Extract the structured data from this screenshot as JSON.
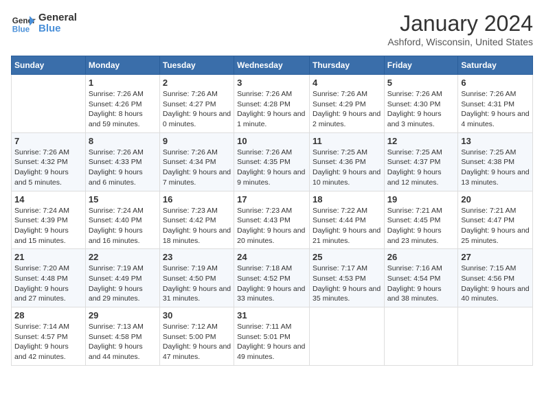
{
  "logo": {
    "line1": "General",
    "line2": "Blue"
  },
  "title": "January 2024",
  "location": "Ashford, Wisconsin, United States",
  "days_of_week": [
    "Sunday",
    "Monday",
    "Tuesday",
    "Wednesday",
    "Thursday",
    "Friday",
    "Saturday"
  ],
  "weeks": [
    [
      {
        "day": "",
        "sunrise": "",
        "sunset": "",
        "daylight": ""
      },
      {
        "day": "1",
        "sunrise": "Sunrise: 7:26 AM",
        "sunset": "Sunset: 4:26 PM",
        "daylight": "Daylight: 8 hours and 59 minutes."
      },
      {
        "day": "2",
        "sunrise": "Sunrise: 7:26 AM",
        "sunset": "Sunset: 4:27 PM",
        "daylight": "Daylight: 9 hours and 0 minutes."
      },
      {
        "day": "3",
        "sunrise": "Sunrise: 7:26 AM",
        "sunset": "Sunset: 4:28 PM",
        "daylight": "Daylight: 9 hours and 1 minute."
      },
      {
        "day": "4",
        "sunrise": "Sunrise: 7:26 AM",
        "sunset": "Sunset: 4:29 PM",
        "daylight": "Daylight: 9 hours and 2 minutes."
      },
      {
        "day": "5",
        "sunrise": "Sunrise: 7:26 AM",
        "sunset": "Sunset: 4:30 PM",
        "daylight": "Daylight: 9 hours and 3 minutes."
      },
      {
        "day": "6",
        "sunrise": "Sunrise: 7:26 AM",
        "sunset": "Sunset: 4:31 PM",
        "daylight": "Daylight: 9 hours and 4 minutes."
      }
    ],
    [
      {
        "day": "7",
        "sunrise": "Sunrise: 7:26 AM",
        "sunset": "Sunset: 4:32 PM",
        "daylight": "Daylight: 9 hours and 5 minutes."
      },
      {
        "day": "8",
        "sunrise": "Sunrise: 7:26 AM",
        "sunset": "Sunset: 4:33 PM",
        "daylight": "Daylight: 9 hours and 6 minutes."
      },
      {
        "day": "9",
        "sunrise": "Sunrise: 7:26 AM",
        "sunset": "Sunset: 4:34 PM",
        "daylight": "Daylight: 9 hours and 7 minutes."
      },
      {
        "day": "10",
        "sunrise": "Sunrise: 7:26 AM",
        "sunset": "Sunset: 4:35 PM",
        "daylight": "Daylight: 9 hours and 9 minutes."
      },
      {
        "day": "11",
        "sunrise": "Sunrise: 7:25 AM",
        "sunset": "Sunset: 4:36 PM",
        "daylight": "Daylight: 9 hours and 10 minutes."
      },
      {
        "day": "12",
        "sunrise": "Sunrise: 7:25 AM",
        "sunset": "Sunset: 4:37 PM",
        "daylight": "Daylight: 9 hours and 12 minutes."
      },
      {
        "day": "13",
        "sunrise": "Sunrise: 7:25 AM",
        "sunset": "Sunset: 4:38 PM",
        "daylight": "Daylight: 9 hours and 13 minutes."
      }
    ],
    [
      {
        "day": "14",
        "sunrise": "Sunrise: 7:24 AM",
        "sunset": "Sunset: 4:39 PM",
        "daylight": "Daylight: 9 hours and 15 minutes."
      },
      {
        "day": "15",
        "sunrise": "Sunrise: 7:24 AM",
        "sunset": "Sunset: 4:40 PM",
        "daylight": "Daylight: 9 hours and 16 minutes."
      },
      {
        "day": "16",
        "sunrise": "Sunrise: 7:23 AM",
        "sunset": "Sunset: 4:42 PM",
        "daylight": "Daylight: 9 hours and 18 minutes."
      },
      {
        "day": "17",
        "sunrise": "Sunrise: 7:23 AM",
        "sunset": "Sunset: 4:43 PM",
        "daylight": "Daylight: 9 hours and 20 minutes."
      },
      {
        "day": "18",
        "sunrise": "Sunrise: 7:22 AM",
        "sunset": "Sunset: 4:44 PM",
        "daylight": "Daylight: 9 hours and 21 minutes."
      },
      {
        "day": "19",
        "sunrise": "Sunrise: 7:21 AM",
        "sunset": "Sunset: 4:45 PM",
        "daylight": "Daylight: 9 hours and 23 minutes."
      },
      {
        "day": "20",
        "sunrise": "Sunrise: 7:21 AM",
        "sunset": "Sunset: 4:47 PM",
        "daylight": "Daylight: 9 hours and 25 minutes."
      }
    ],
    [
      {
        "day": "21",
        "sunrise": "Sunrise: 7:20 AM",
        "sunset": "Sunset: 4:48 PM",
        "daylight": "Daylight: 9 hours and 27 minutes."
      },
      {
        "day": "22",
        "sunrise": "Sunrise: 7:19 AM",
        "sunset": "Sunset: 4:49 PM",
        "daylight": "Daylight: 9 hours and 29 minutes."
      },
      {
        "day": "23",
        "sunrise": "Sunrise: 7:19 AM",
        "sunset": "Sunset: 4:50 PM",
        "daylight": "Daylight: 9 hours and 31 minutes."
      },
      {
        "day": "24",
        "sunrise": "Sunrise: 7:18 AM",
        "sunset": "Sunset: 4:52 PM",
        "daylight": "Daylight: 9 hours and 33 minutes."
      },
      {
        "day": "25",
        "sunrise": "Sunrise: 7:17 AM",
        "sunset": "Sunset: 4:53 PM",
        "daylight": "Daylight: 9 hours and 35 minutes."
      },
      {
        "day": "26",
        "sunrise": "Sunrise: 7:16 AM",
        "sunset": "Sunset: 4:54 PM",
        "daylight": "Daylight: 9 hours and 38 minutes."
      },
      {
        "day": "27",
        "sunrise": "Sunrise: 7:15 AM",
        "sunset": "Sunset: 4:56 PM",
        "daylight": "Daylight: 9 hours and 40 minutes."
      }
    ],
    [
      {
        "day": "28",
        "sunrise": "Sunrise: 7:14 AM",
        "sunset": "Sunset: 4:57 PM",
        "daylight": "Daylight: 9 hours and 42 minutes."
      },
      {
        "day": "29",
        "sunrise": "Sunrise: 7:13 AM",
        "sunset": "Sunset: 4:58 PM",
        "daylight": "Daylight: 9 hours and 44 minutes."
      },
      {
        "day": "30",
        "sunrise": "Sunrise: 7:12 AM",
        "sunset": "Sunset: 5:00 PM",
        "daylight": "Daylight: 9 hours and 47 minutes."
      },
      {
        "day": "31",
        "sunrise": "Sunrise: 7:11 AM",
        "sunset": "Sunset: 5:01 PM",
        "daylight": "Daylight: 9 hours and 49 minutes."
      },
      {
        "day": "",
        "sunrise": "",
        "sunset": "",
        "daylight": ""
      },
      {
        "day": "",
        "sunrise": "",
        "sunset": "",
        "daylight": ""
      },
      {
        "day": "",
        "sunrise": "",
        "sunset": "",
        "daylight": ""
      }
    ]
  ]
}
